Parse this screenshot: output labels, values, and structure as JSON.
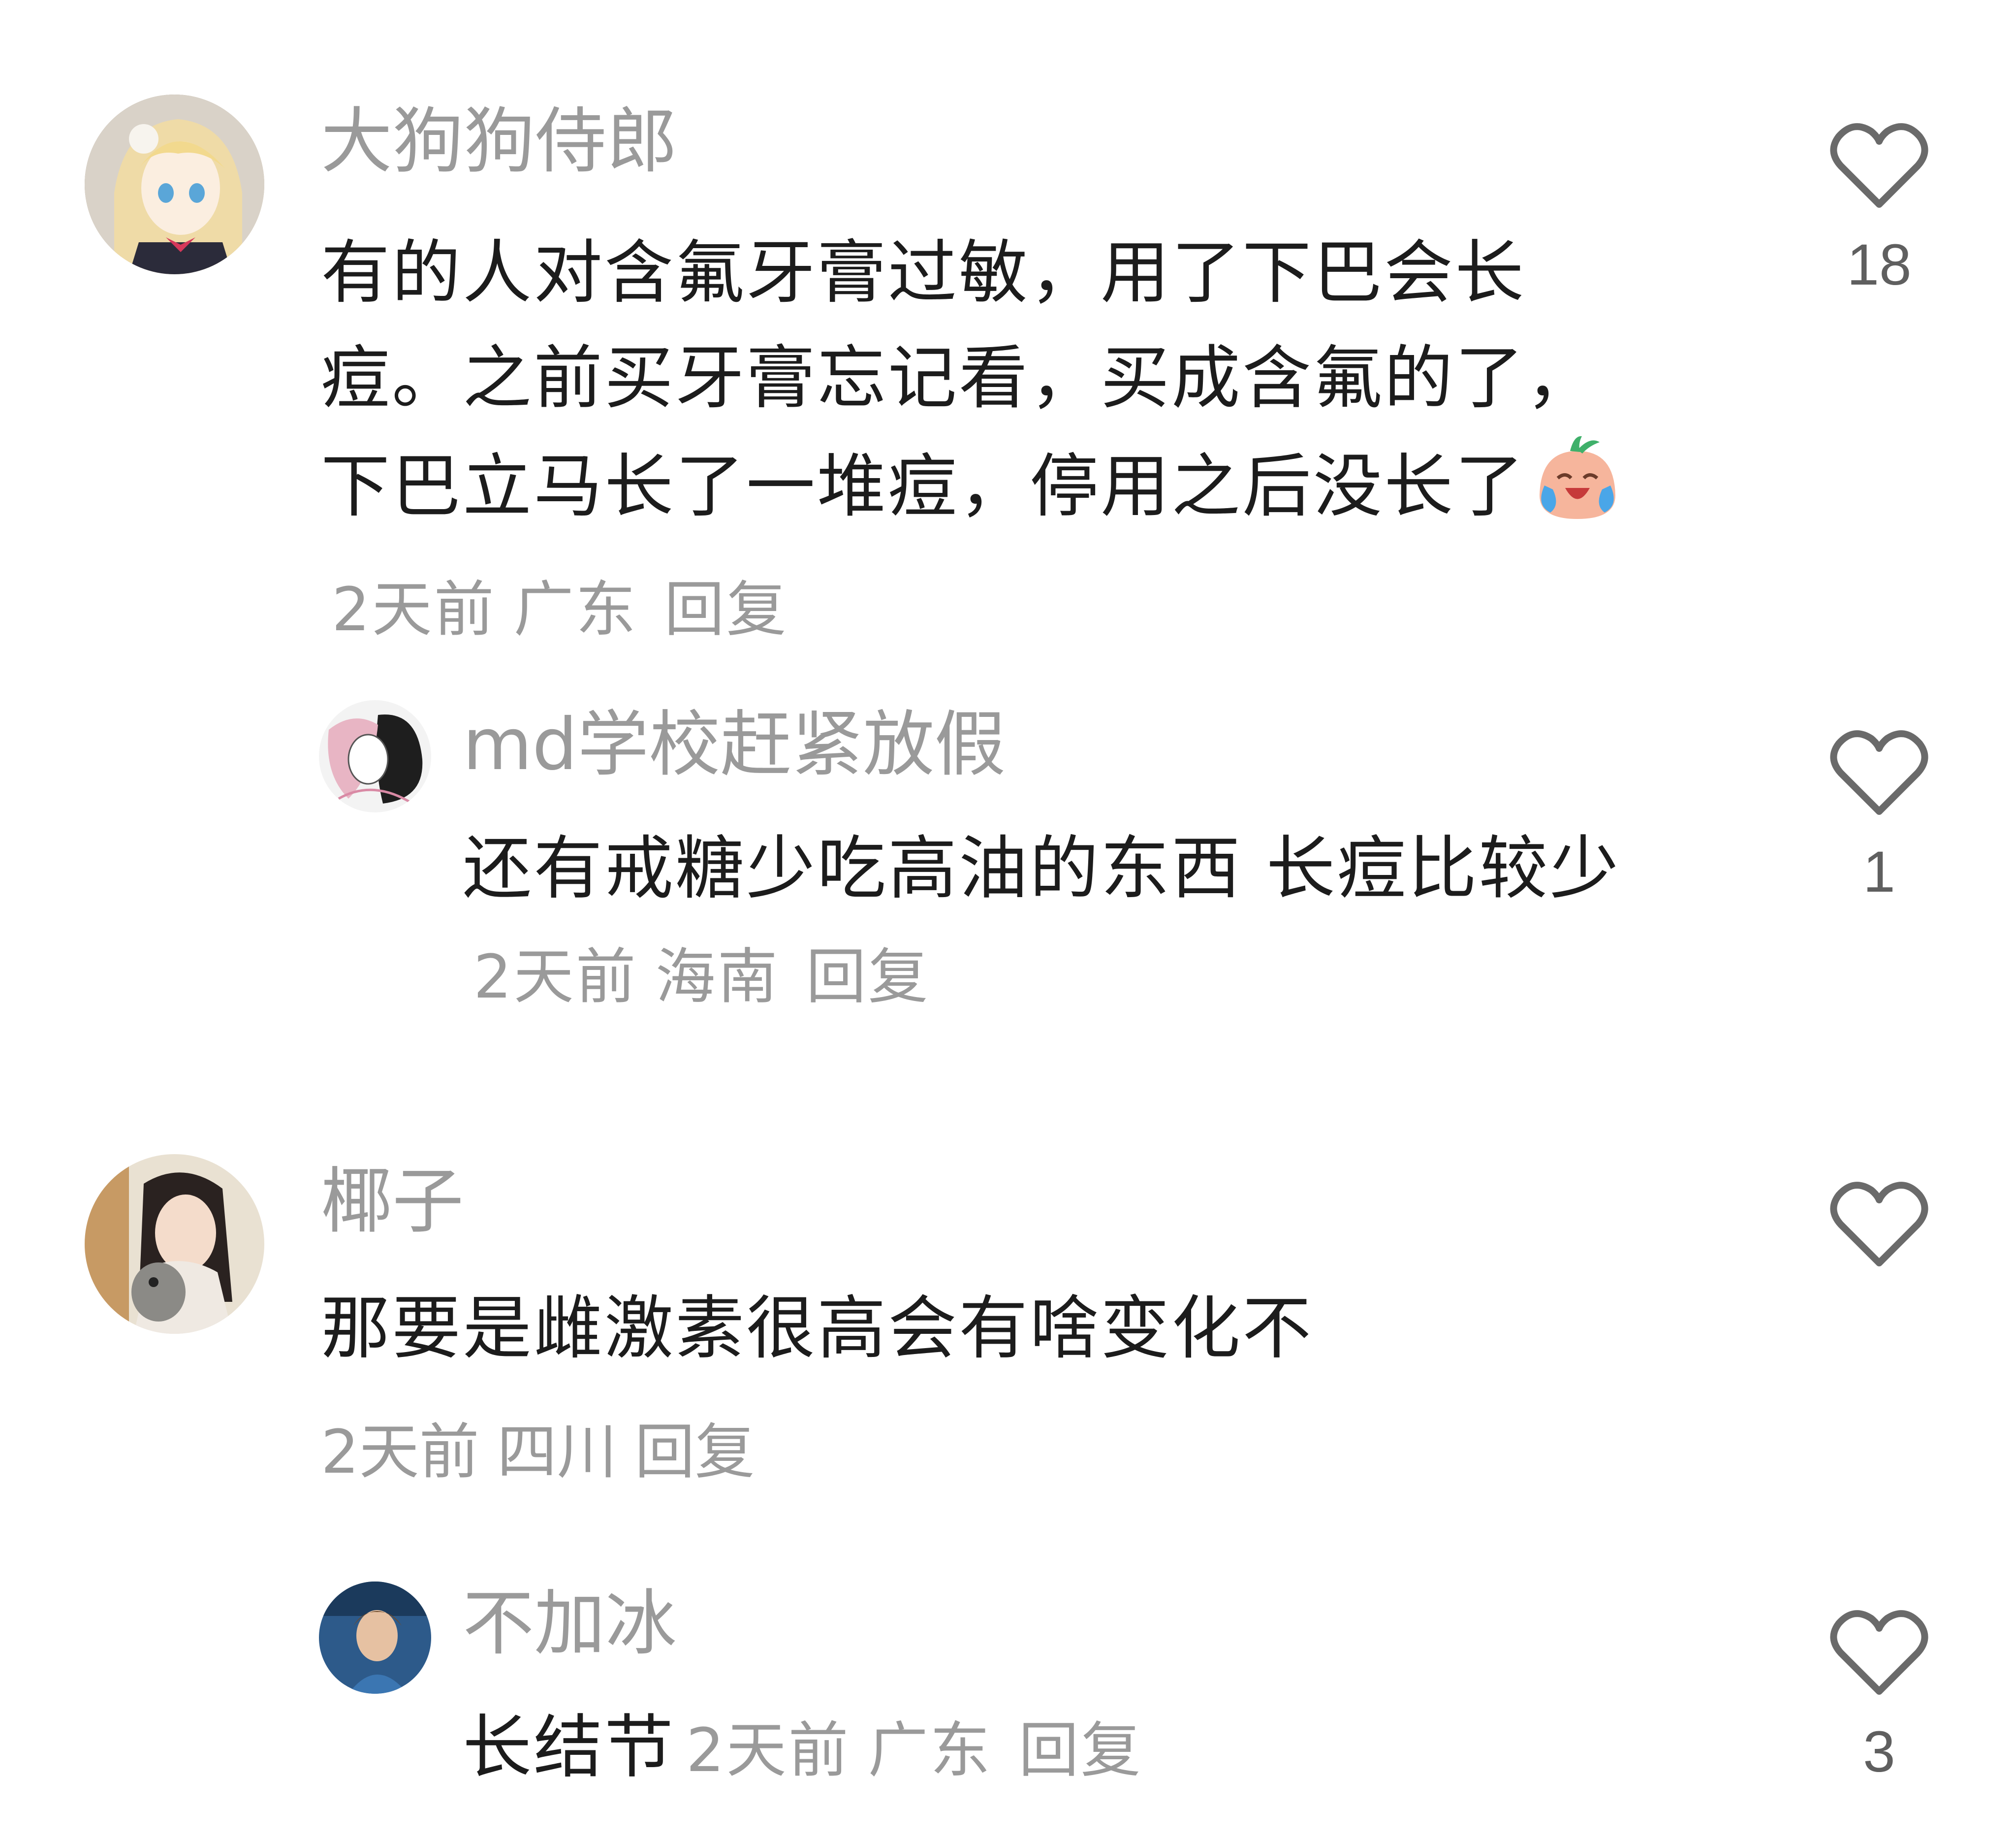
{
  "comments": [
    {
      "username": "大狗狗侍郎",
      "text": "有的人对含氟牙膏过敏，用了下巴会长痘。之前买牙膏忘记看，买成含氟的了，下巴立马长了一堆痘，停用之后没长了",
      "emoji": "crying-laughing-face-icon",
      "time": "2天前",
      "location": "广东",
      "reply_label": "回复",
      "likes": "18",
      "replies": [
        {
          "username": "md学校赶紧放假",
          "text": "还有戒糖少吃高油的东西 长痘比较少",
          "time": "2天前",
          "location": "海南",
          "reply_label": "回复",
          "likes": "1"
        }
      ]
    },
    {
      "username": "椰子",
      "text": "那要是雌激素很高会有啥变化不",
      "time": "2天前",
      "location": "四川",
      "reply_label": "回复",
      "likes": "",
      "replies": [
        {
          "username": "不加冰",
          "text": "长结节",
          "time": "2天前",
          "location": "广东",
          "reply_label": "回复",
          "likes": "3"
        }
      ]
    }
  ],
  "colors": {
    "username": "#9a9a9a",
    "text": "#1c1c1c",
    "meta": "#9a9a9a",
    "heart": "#6a6a6a"
  }
}
